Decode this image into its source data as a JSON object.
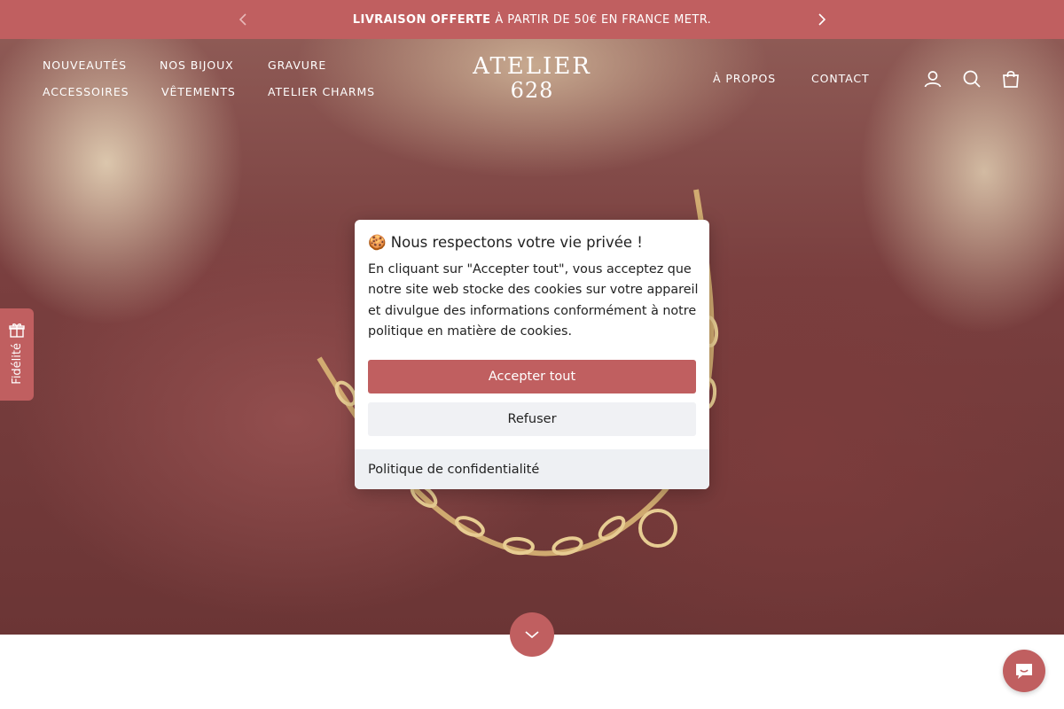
{
  "announcement": {
    "bold_text": "LIVRAISON OFFERTE",
    "text": "À PARTIR DE 50€ EN FRANCE METR.",
    "prev_icon": "chevron-left-icon",
    "next_icon": "chevron-right-icon",
    "background": "#c05f60"
  },
  "header": {
    "nav_left": [
      {
        "label": "NOUVEAUTÉS"
      },
      {
        "label": "NOS BIJOUX"
      },
      {
        "label": "GRAVURE"
      },
      {
        "label": "ACCESSOIRES"
      },
      {
        "label": "VÊTEMENTS"
      },
      {
        "label": "ATELIER CHARMS"
      }
    ],
    "logo": {
      "line1": "ATELIER",
      "line2": "628"
    },
    "nav_right": [
      {
        "label": "À PROPOS"
      },
      {
        "label": "CONTACT"
      }
    ],
    "icons": [
      "account-icon",
      "search-icon",
      "cart-icon"
    ]
  },
  "loyalty": {
    "label": "Fidélité",
    "icon": "gift-icon"
  },
  "cookie_banner": {
    "title": "🍪 Nous respectons votre vie privée !",
    "body": "En cliquant sur \"Accepter tout\", vous acceptez que notre site web stocke des cookies sur votre appareil et divulgue des informations conformément à notre politique en matière de cookies.",
    "accept_label": "Accepter tout",
    "refuse_label": "Refuser",
    "policy_link": "Politique de confidentialité"
  },
  "scroll_button": {
    "icon": "chevron-down-icon"
  },
  "chat_button": {
    "icon": "chat-icon"
  },
  "colors": {
    "accent": "#c05f60",
    "text": "#222222",
    "footer_bg": "#eef0f3",
    "refuse_bg": "#f0f1f4"
  }
}
